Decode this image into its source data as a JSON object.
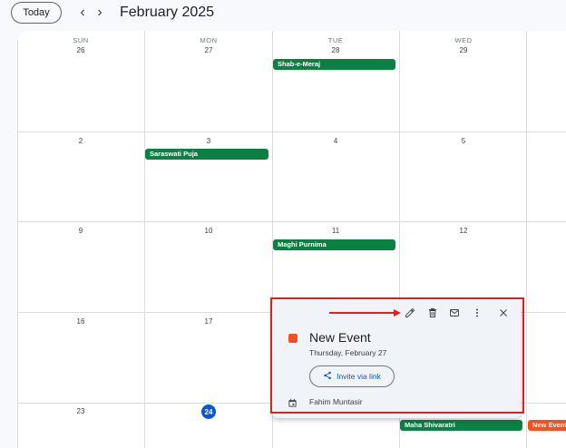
{
  "toolbar": {
    "today_label": "Today",
    "prev_icon": "chevron-left-icon",
    "next_icon": "chevron-right-icon",
    "month_title": "February 2025"
  },
  "calendar": {
    "weekdays": [
      "SUN",
      "MON",
      "TUE",
      "WED"
    ],
    "weeks": [
      [
        "26",
        "27",
        "28",
        "29"
      ],
      [
        "2",
        "3",
        "4",
        "5"
      ],
      [
        "9",
        "10",
        "11",
        "12"
      ],
      [
        "16",
        "17",
        "",
        ""
      ],
      [
        "23",
        "24",
        "",
        ""
      ]
    ],
    "today": "24",
    "events": {
      "shab_e_meraj": "Shab-e-Meraj",
      "saraswati_puja": "Saraswati Puja",
      "maghi_purnima": "Maghi Purnima",
      "maha_shivaratri": "Maha Shivaratri",
      "new_event_chip": "New Event"
    },
    "colors": {
      "holiday": "#0b8043",
      "event": "#f4511e",
      "today": "#0b57d0",
      "highlight": "#e02020"
    }
  },
  "popup": {
    "icons": [
      "edit-icon",
      "delete-icon",
      "email-icon",
      "more-options-icon",
      "close-icon"
    ],
    "event_title": "New Event",
    "event_date": "Thursday, February 27",
    "invite_label": "Invite via link",
    "owner_icon": "calendar-icon",
    "owner_name": "Fahim Muntasir"
  }
}
